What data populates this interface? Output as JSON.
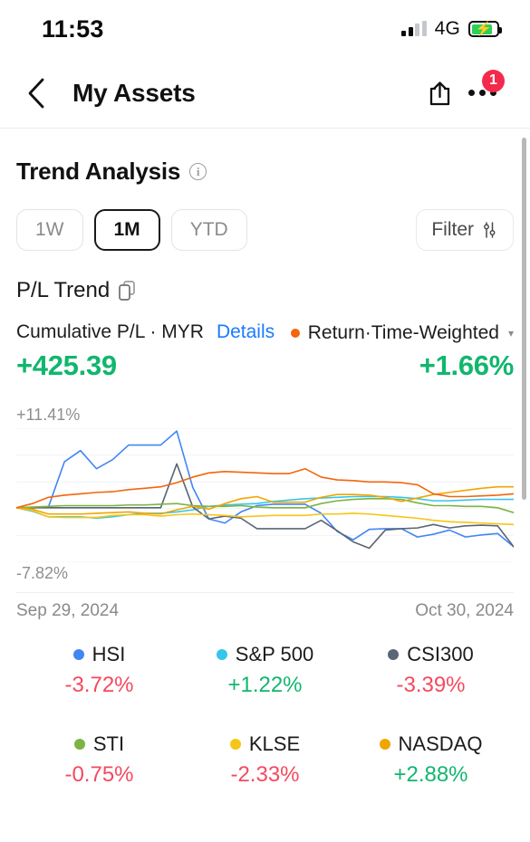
{
  "status_bar": {
    "time": "11:53",
    "network": "4G",
    "signal_icon": "signal-bars-icon",
    "battery_icon": "battery-charging-icon",
    "bolt_glyph": "⚡"
  },
  "nav": {
    "back_icon": "chevron-left-icon",
    "title": "My Assets",
    "share_icon": "share-icon",
    "more_icon": "more-dots-icon",
    "badge_count": "1"
  },
  "section": {
    "title": "Trend Analysis",
    "info_icon": "info-icon",
    "info_glyph": "i"
  },
  "range_chips": [
    {
      "label": "1W",
      "active": false
    },
    {
      "label": "1M",
      "active": true
    },
    {
      "label": "YTD",
      "active": false
    }
  ],
  "filter": {
    "label": "Filter",
    "icon": "sliders-icon"
  },
  "pl_trend": {
    "label": "P/L Trend",
    "copy_icon": "copy-icon"
  },
  "summary": {
    "left_caption": "Cumulative P/L · MYR",
    "details_label": "Details",
    "left_value": "+425.39",
    "right_caption": "Return·Time-Weighted",
    "right_dot_color": "#f4650c",
    "right_caret": "▾",
    "right_value": "+1.66%",
    "positive_color": "#12b66e"
  },
  "chart_data": {
    "type": "line",
    "title": "P/L Trend",
    "xlabel": "",
    "ylabel": "",
    "ylim": [
      -7.82,
      11.41
    ],
    "axis_top_label": "+11.41%",
    "axis_bottom_label": "-7.82%",
    "x_start_label": "Sep 29, 2024",
    "x_end_label": "Oct 30, 2024",
    "grid": true,
    "legend_position": "below",
    "x": [
      0,
      1,
      2,
      3,
      4,
      5,
      6,
      7,
      8,
      9,
      10,
      11,
      12,
      13,
      14,
      15,
      16,
      17,
      18,
      19,
      20,
      21,
      22,
      23,
      24,
      25,
      26,
      27,
      28,
      29,
      30,
      31
    ],
    "series": [
      {
        "name": "HSI",
        "color": "#4285f4",
        "change": "-3.72%",
        "direction": "down",
        "values": [
          0.0,
          0.0,
          0.1,
          6.6,
          8.2,
          5.6,
          6.9,
          9.0,
          9.0,
          9.0,
          11.0,
          2.9,
          -1.6,
          -2.2,
          -0.6,
          0.3,
          0.5,
          0.5,
          0.5,
          -0.8,
          -3.4,
          -4.6,
          -3.1,
          -3.0,
          -3.0,
          -4.2,
          -3.8,
          -3.2,
          -4.2,
          -3.9,
          -3.7,
          -5.6
        ]
      },
      {
        "name": "S&P 500",
        "color": "#34c6eb",
        "change": "+1.22%",
        "direction": "up",
        "values": [
          0.0,
          -0.5,
          -1.3,
          -1.3,
          -1.3,
          -1.5,
          -1.3,
          -1.0,
          -0.8,
          -0.8,
          -0.6,
          -0.3,
          0.2,
          0.4,
          0.5,
          0.6,
          0.9,
          1.1,
          1.3,
          1.4,
          1.5,
          1.6,
          1.6,
          1.6,
          1.5,
          1.3,
          1.0,
          1.0,
          1.1,
          1.2,
          1.2,
          1.2
        ]
      },
      {
        "name": "CSI300",
        "color": "#5a6575",
        "change": "-3.39%",
        "direction": "down",
        "values": [
          0.0,
          0.0,
          0.0,
          0.0,
          0.0,
          0.0,
          0.0,
          0.0,
          0.0,
          0.0,
          6.3,
          0.1,
          -1.6,
          -1.2,
          -1.5,
          -3.0,
          -3.0,
          -3.0,
          -3.0,
          -1.8,
          -3.3,
          -4.9,
          -5.8,
          -3.2,
          -3.0,
          -2.9,
          -2.4,
          -2.9,
          -2.6,
          -2.5,
          -2.6,
          -5.6
        ]
      },
      {
        "name": "STI",
        "color": "#7cb342",
        "change": "-0.75%",
        "direction": "down",
        "values": [
          0.0,
          0.1,
          0.2,
          0.3,
          0.3,
          0.3,
          0.3,
          0.4,
          0.4,
          0.5,
          0.6,
          0.3,
          0.2,
          0.2,
          0.3,
          0.1,
          0.0,
          0.0,
          0.0,
          0.6,
          1.0,
          1.2,
          1.3,
          1.3,
          1.2,
          0.7,
          0.3,
          0.3,
          0.2,
          0.2,
          0.0,
          -0.7
        ]
      },
      {
        "name": "KLSE",
        "color": "#f5c518",
        "change": "-2.33%",
        "direction": "down",
        "values": [
          0.0,
          -0.4,
          -1.3,
          -1.4,
          -1.4,
          -1.4,
          -1.1,
          -1.0,
          -1.0,
          -1.2,
          -1.0,
          -0.9,
          -1.0,
          -1.1,
          -1.3,
          -1.2,
          -1.1,
          -1.1,
          -1.1,
          -0.9,
          -0.9,
          -0.8,
          -0.9,
          -1.1,
          -1.3,
          -1.5,
          -1.8,
          -2.0,
          -2.1,
          -2.2,
          -2.3,
          -2.4
        ]
      },
      {
        "name": "NASDAQ",
        "color": "#f0a500",
        "change": "+2.88%",
        "direction": "up",
        "values": [
          0.0,
          -0.2,
          -0.9,
          -0.9,
          -0.9,
          -0.8,
          -0.7,
          -0.6,
          -0.8,
          -0.9,
          -0.3,
          0.2,
          -0.2,
          0.6,
          1.3,
          1.6,
          0.8,
          0.8,
          0.8,
          1.5,
          1.9,
          1.9,
          1.8,
          1.5,
          0.9,
          1.4,
          1.9,
          2.2,
          2.5,
          2.8,
          3.0,
          3.0
        ]
      },
      {
        "name": "Return-Time-Weighted",
        "color": "#f4650c",
        "change": "+1.66%",
        "direction": "up",
        "values": [
          0.0,
          0.6,
          1.5,
          1.8,
          2.0,
          2.2,
          2.3,
          2.6,
          2.8,
          3.0,
          3.6,
          4.4,
          5.0,
          5.2,
          5.1,
          5.0,
          4.9,
          4.9,
          5.6,
          4.4,
          4.0,
          3.9,
          3.7,
          3.7,
          3.6,
          3.3,
          2.0,
          1.6,
          1.6,
          1.7,
          1.8,
          2.0
        ]
      }
    ]
  },
  "legend": [
    {
      "name": "HSI",
      "color": "#4285f4",
      "change": "-3.72%",
      "direction": "down"
    },
    {
      "name": "S&P 500",
      "color": "#34c6eb",
      "change": "+1.22%",
      "direction": "up"
    },
    {
      "name": "CSI300",
      "color": "#5a6575",
      "change": "-3.39%",
      "direction": "down"
    },
    {
      "name": "STI",
      "color": "#7cb342",
      "change": "-0.75%",
      "direction": "down"
    },
    {
      "name": "KLSE",
      "color": "#f5c518",
      "change": "-2.33%",
      "direction": "down"
    },
    {
      "name": "NASDAQ",
      "color": "#f0a500",
      "change": "+2.88%",
      "direction": "up"
    }
  ]
}
